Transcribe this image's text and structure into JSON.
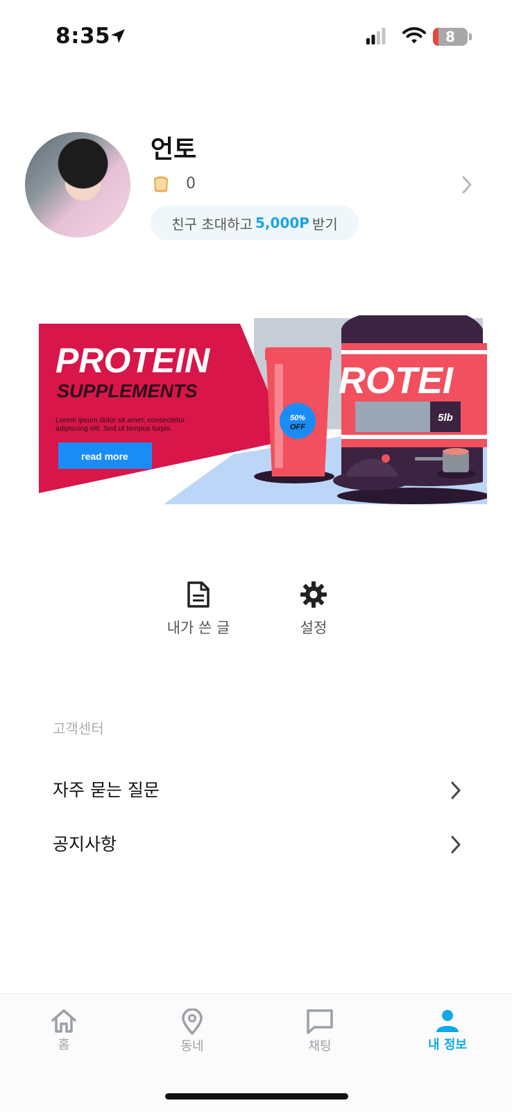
{
  "status_bar": {
    "time": "8:35",
    "battery": "8"
  },
  "profile": {
    "name": "언토",
    "points": "0",
    "invite": {
      "prefix": "친구 초대하고",
      "amount": "5,000P",
      "suffix": "받기"
    }
  },
  "banner": {
    "title": "PROTEIN",
    "subtitle": "SUPPLEMENTS",
    "body_line1": "Lorem ipsum dolor sit amet, consectetur",
    "body_line2": "adipiscing elit. Sed ut tempus turpis.",
    "button": "read more",
    "discount_line1": "50%",
    "discount_line2": "OFF",
    "jar_label": "ROTEI",
    "jar_weight": "5lb"
  },
  "shortcuts": {
    "my_posts": "내가 쓴 글",
    "settings": "설정"
  },
  "customer_center": {
    "title": "고객센터",
    "items": [
      {
        "label": "자주 묻는 질문"
      },
      {
        "label": "공지사항"
      }
    ]
  },
  "tabs": [
    {
      "label": "홈",
      "icon": "home-icon"
    },
    {
      "label": "동네",
      "icon": "location-pin-icon"
    },
    {
      "label": "채팅",
      "icon": "chat-bubble-icon"
    },
    {
      "label": "내 정보",
      "icon": "person-icon"
    }
  ],
  "colors": {
    "accent": "#11a8e8",
    "banner_red": "#d81649",
    "banner_button": "#1a8cf5"
  }
}
